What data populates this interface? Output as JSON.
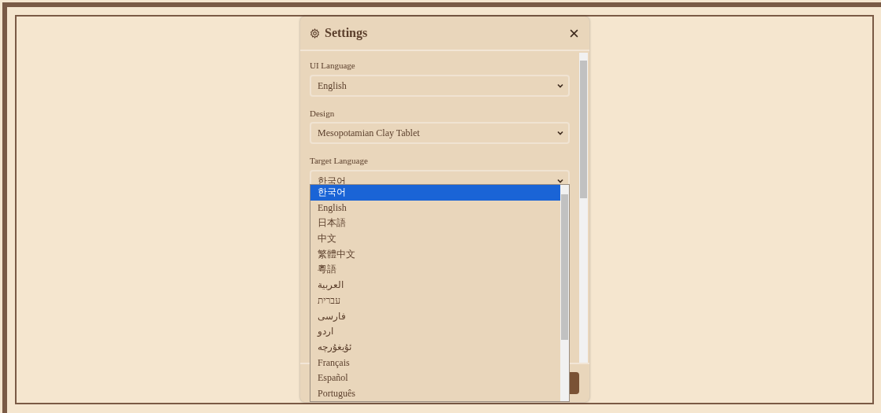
{
  "dialog": {
    "title": "Settings",
    "fields": [
      {
        "label": "UI Language",
        "value": "English"
      },
      {
        "label": "Design",
        "value": "Mesopotamian Clay Tablet"
      },
      {
        "label": "Target Language",
        "value": "한국어"
      }
    ]
  },
  "dropdown": {
    "options": [
      {
        "label": "한국어",
        "selected": true
      },
      {
        "label": "English",
        "selected": false
      },
      {
        "label": "日本語",
        "selected": false
      },
      {
        "label": "中文",
        "selected": false
      },
      {
        "label": "繁體中文",
        "selected": false
      },
      {
        "label": "粵語",
        "selected": false
      },
      {
        "label": "العربية",
        "selected": false
      },
      {
        "label": "עברית",
        "selected": false
      },
      {
        "label": "فارسی",
        "selected": false
      },
      {
        "label": "اردو",
        "selected": false
      },
      {
        "label": "ئۇيغۇرچە",
        "selected": false
      },
      {
        "label": "Français",
        "selected": false
      },
      {
        "label": "Español",
        "selected": false
      },
      {
        "label": "Português",
        "selected": false
      }
    ]
  }
}
